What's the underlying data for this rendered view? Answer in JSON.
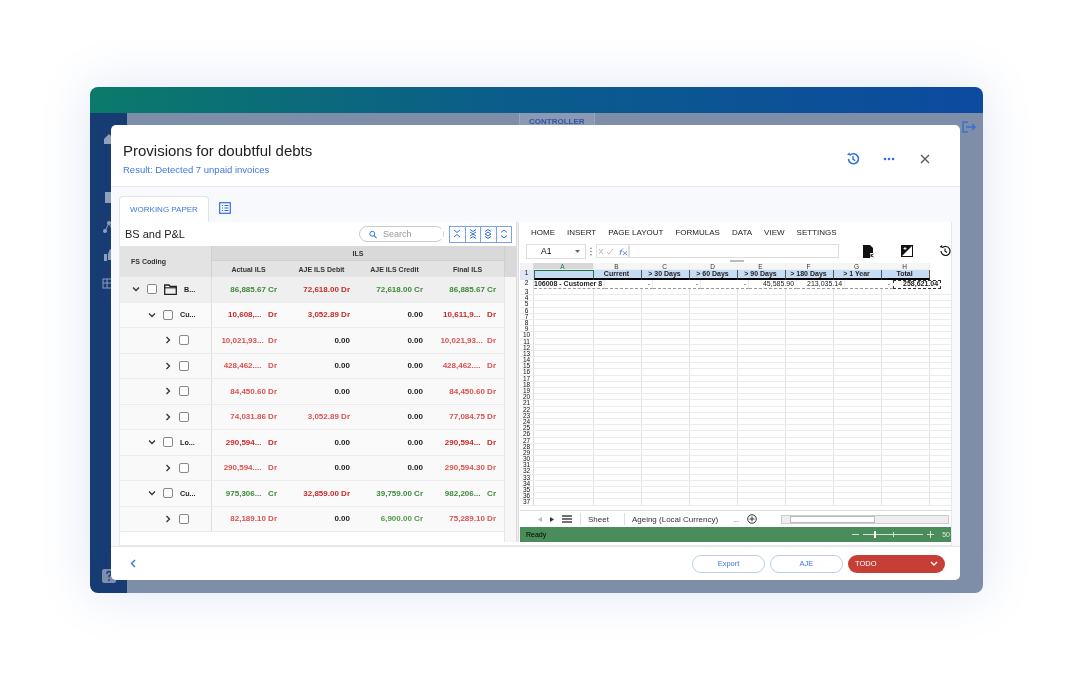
{
  "background_app": {
    "tab": "CONTROLLER"
  },
  "dialog": {
    "title": "Provisions for doubtful debts",
    "subtitle": "Result: Detected 7 unpaid invoices"
  },
  "tabs": [
    {
      "kind": "text",
      "label": "WORKING PAPER",
      "selected": true
    },
    {
      "kind": "icon",
      "selected": false
    }
  ],
  "panel": {
    "title": "BS and P&L",
    "search": {
      "placeholder": "Search"
    }
  },
  "table": {
    "tree_header": "FS Coding",
    "group_header": "ILS",
    "columns": [
      "Actual ILS",
      "AJE ILS Debit",
      "AJE ILS Credit",
      "Final ILS"
    ],
    "rows": [
      {
        "label": "B...",
        "expanded": true,
        "checked": false,
        "cells": [
          {
            "text": "86,885.67 Cr",
            "color": "#3d8a3a"
          },
          {
            "text": "72,618.00 Dr",
            "color": "#c62a2a"
          },
          {
            "text": "72,618.00 Cr",
            "color": "#3d8a3a"
          },
          {
            "text": "86,885.67 Cr",
            "color": "#3d8a3a"
          }
        ],
        "children": [
          {
            "label": "Cu...",
            "expanded": true,
            "checked": false,
            "cells": [
              {
                "text": "10,608,...   Dr",
                "color": "#c62a2a"
              },
              {
                "text": "3,052.89 Dr",
                "color": "#c62a2a"
              },
              {
                "text": "0.00",
                "color": "#222222"
              },
              {
                "text": "10,611,9...   Dr",
                "color": "#c62a2a"
              }
            ],
            "children": [
              {
                "expanded": false,
                "checked": false,
                "cells": [
                  {
                    "text": "10,021,93...  Dr",
                    "color": "#d9534f"
                  },
                  {
                    "text": "0.00",
                    "color": "#222222"
                  },
                  {
                    "text": "0.00",
                    "color": "#222222"
                  },
                  {
                    "text": "10,021,93...  Dr",
                    "color": "#d9534f"
                  }
                ]
              },
              {
                "expanded": false,
                "checked": false,
                "cells": [
                  {
                    "text": "428,462....   Dr",
                    "color": "#d9534f"
                  },
                  {
                    "text": "0.00",
                    "color": "#222222"
                  },
                  {
                    "text": "0.00",
                    "color": "#222222"
                  },
                  {
                    "text": "428,462....   Dr",
                    "color": "#d9534f"
                  }
                ]
              },
              {
                "expanded": false,
                "checked": false,
                "cells": [
                  {
                    "text": "84,450.60 Dr",
                    "color": "#d9534f"
                  },
                  {
                    "text": "0.00",
                    "color": "#222222"
                  },
                  {
                    "text": "0.00",
                    "color": "#222222"
                  },
                  {
                    "text": "84,450.60 Dr",
                    "color": "#d9534f"
                  }
                ]
              },
              {
                "expanded": false,
                "checked": false,
                "cells": [
                  {
                    "text": "74,031.86 Dr",
                    "color": "#d9534f"
                  },
                  {
                    "text": "3,052.89 Dr",
                    "color": "#d9534f"
                  },
                  {
                    "text": "0.00",
                    "color": "#222222"
                  },
                  {
                    "text": "77,084.75 Dr",
                    "color": "#d9534f"
                  }
                ]
              }
            ]
          },
          {
            "label": "Lo...",
            "expanded": true,
            "checked": false,
            "cells": [
              {
                "text": "290,594...   Dr",
                "color": "#c62a2a"
              },
              {
                "text": "0.00",
                "color": "#222222"
              },
              {
                "text": "0.00",
                "color": "#222222"
              },
              {
                "text": "290,594...   Dr",
                "color": "#c62a2a"
              }
            ],
            "children": [
              {
                "expanded": false,
                "checked": false,
                "cells": [
                  {
                    "text": "290,594....   Dr",
                    "color": "#d9534f"
                  },
                  {
                    "text": "0.00",
                    "color": "#222222"
                  },
                  {
                    "text": "0.00",
                    "color": "#222222"
                  },
                  {
                    "text": "290,594.30 Dr",
                    "color": "#d9534f"
                  }
                ]
              }
            ]
          },
          {
            "label": "Cu...",
            "expanded": true,
            "checked": false,
            "cells": [
              {
                "text": "975,306...   Cr",
                "color": "#3d8a3a"
              },
              {
                "text": "32,859.00 Dr",
                "color": "#c62a2a"
              },
              {
                "text": "39,759.00 Cr",
                "color": "#3d8a3a"
              },
              {
                "text": "982,206...   Cr",
                "color": "#3d8a3a"
              }
            ],
            "children": [
              {
                "expanded": false,
                "checked": false,
                "cells": [
                  {
                    "text": "82,189.10 Dr",
                    "color": "#d9534f"
                  },
                  {
                    "text": "0.00",
                    "color": "#222222"
                  },
                  {
                    "text": "6,900.00 Cr",
                    "color": "#4f9a4c"
                  },
                  {
                    "text": "75,289.10 Dr",
                    "color": "#d9534f"
                  }
                ]
              }
            ]
          }
        ]
      }
    ]
  },
  "spreadsheet": {
    "menu": [
      "HOME",
      "INSERT",
      "PAGE LAYOUT",
      "FORMULAS",
      "DATA",
      "VIEW",
      "SETTINGS"
    ],
    "name_box": "A1",
    "columns": [
      {
        "letter": "A",
        "selected": true
      },
      {
        "letter": "B",
        "selected": false
      },
      {
        "letter": "C",
        "selected": false
      },
      {
        "letter": "D",
        "selected": false
      },
      {
        "letter": "E",
        "selected": false
      },
      {
        "letter": "F",
        "selected": false
      },
      {
        "letter": "G",
        "selected": false
      },
      {
        "letter": "H",
        "selected": false
      }
    ],
    "rows": [
      {
        "number": "1",
        "kind": "header",
        "selected": true,
        "cells": [
          null,
          "Current",
          "> 30 Days",
          "> 60 Days",
          "> 90 Days",
          "> 180 Days",
          "> 1 Year",
          "Total"
        ]
      },
      {
        "number": "2",
        "kind": "data",
        "selected": false,
        "cells": [
          "106008 - Customer 8",
          "-",
          "-",
          "-",
          "45,585.90",
          "213,035.14",
          "-",
          "258,621.04"
        ]
      },
      {
        "number": "3",
        "selected": false
      },
      {
        "number": "4",
        "selected": false
      },
      {
        "number": "5",
        "selected": false
      },
      {
        "number": "6",
        "selected": false
      },
      {
        "number": "7",
        "selected": false
      },
      {
        "number": "8",
        "selected": false
      },
      {
        "number": "9",
        "selected": false
      },
      {
        "number": "10",
        "selected": false
      },
      {
        "number": "11",
        "selected": false
      },
      {
        "number": "12",
        "selected": false
      },
      {
        "number": "13",
        "selected": false
      },
      {
        "number": "14",
        "selected": false
      },
      {
        "number": "15",
        "selected": false
      },
      {
        "number": "16",
        "selected": false
      },
      {
        "number": "17",
        "selected": false
      },
      {
        "number": "18",
        "selected": false
      },
      {
        "number": "19",
        "selected": false
      },
      {
        "number": "20",
        "selected": false
      },
      {
        "number": "21",
        "selected": false
      },
      {
        "number": "22",
        "selected": false
      },
      {
        "number": "23",
        "selected": false
      },
      {
        "number": "24",
        "selected": false
      },
      {
        "number": "25",
        "selected": false
      },
      {
        "number": "26",
        "selected": false
      },
      {
        "number": "27",
        "selected": false
      },
      {
        "number": "28",
        "selected": false
      },
      {
        "number": "29",
        "selected": false
      },
      {
        "number": "30",
        "selected": false
      },
      {
        "number": "31",
        "selected": false
      },
      {
        "number": "32",
        "selected": false
      },
      {
        "number": "33",
        "selected": false
      },
      {
        "number": "34",
        "selected": false
      },
      {
        "number": "35",
        "selected": false
      },
      {
        "number": "36",
        "selected": false
      },
      {
        "number": "37",
        "selected": false
      }
    ],
    "sheet_tabs": [
      "Sheet",
      "Ageing (Local Currency)"
    ],
    "more_tabs": "...",
    "status": "Ready",
    "zoom_slider": {
      "level": 0.18
    },
    "zoom_reading": "50"
  },
  "footer": {
    "buttons": [
      {
        "kind": "outline",
        "label": "Export"
      },
      {
        "kind": "outline",
        "label": "AJE"
      },
      {
        "kind": "dropdown",
        "label": "TODO"
      }
    ]
  }
}
